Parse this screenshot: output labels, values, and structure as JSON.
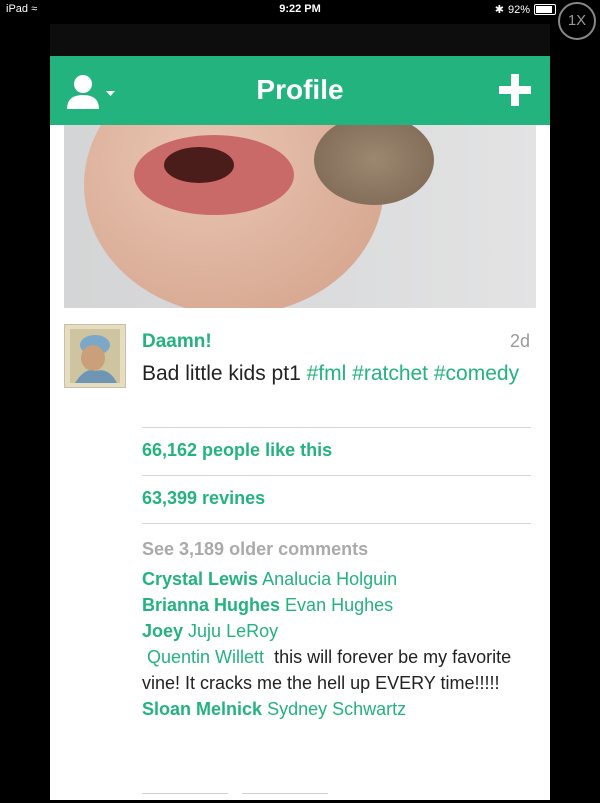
{
  "status_bar": {
    "device": "iPad",
    "time": "9:22 PM",
    "battery": "92%",
    "zoom": "1X"
  },
  "app_bar": {
    "title": "Profile"
  },
  "post": {
    "author": "Daamn!",
    "time_ago": "2d",
    "caption_text": "Bad little kids pt1",
    "hashtags": [
      "#fml",
      "#ratchet",
      "#comedy"
    ],
    "likes": "66,162 people like this",
    "revines": "63,399 revines",
    "older_comments": "See 3,189 older comments",
    "comments": [
      {
        "user": "Crystal Lewis",
        "text": "Analucia Holguin"
      },
      {
        "user": "Brianna Hughes",
        "text": "Evan Hughes"
      },
      {
        "user": "Joey",
        "text": "Juju LeRoy"
      },
      {
        "user": "",
        "mention": "Quentin Willett",
        "text": "this will forever be my favorite vine! It cracks me the hell up EVERY time!!!!!"
      },
      {
        "user": "Sloan Melnick",
        "text": "Sydney Schwartz"
      }
    ]
  },
  "colors": {
    "accent": "#23b37e",
    "background": "#000000",
    "panel": "#ffffff"
  },
  "icons": [
    "wifi-icon",
    "bluetooth-icon",
    "battery-icon",
    "profile-icon",
    "chevron-down-icon",
    "plus-icon"
  ]
}
